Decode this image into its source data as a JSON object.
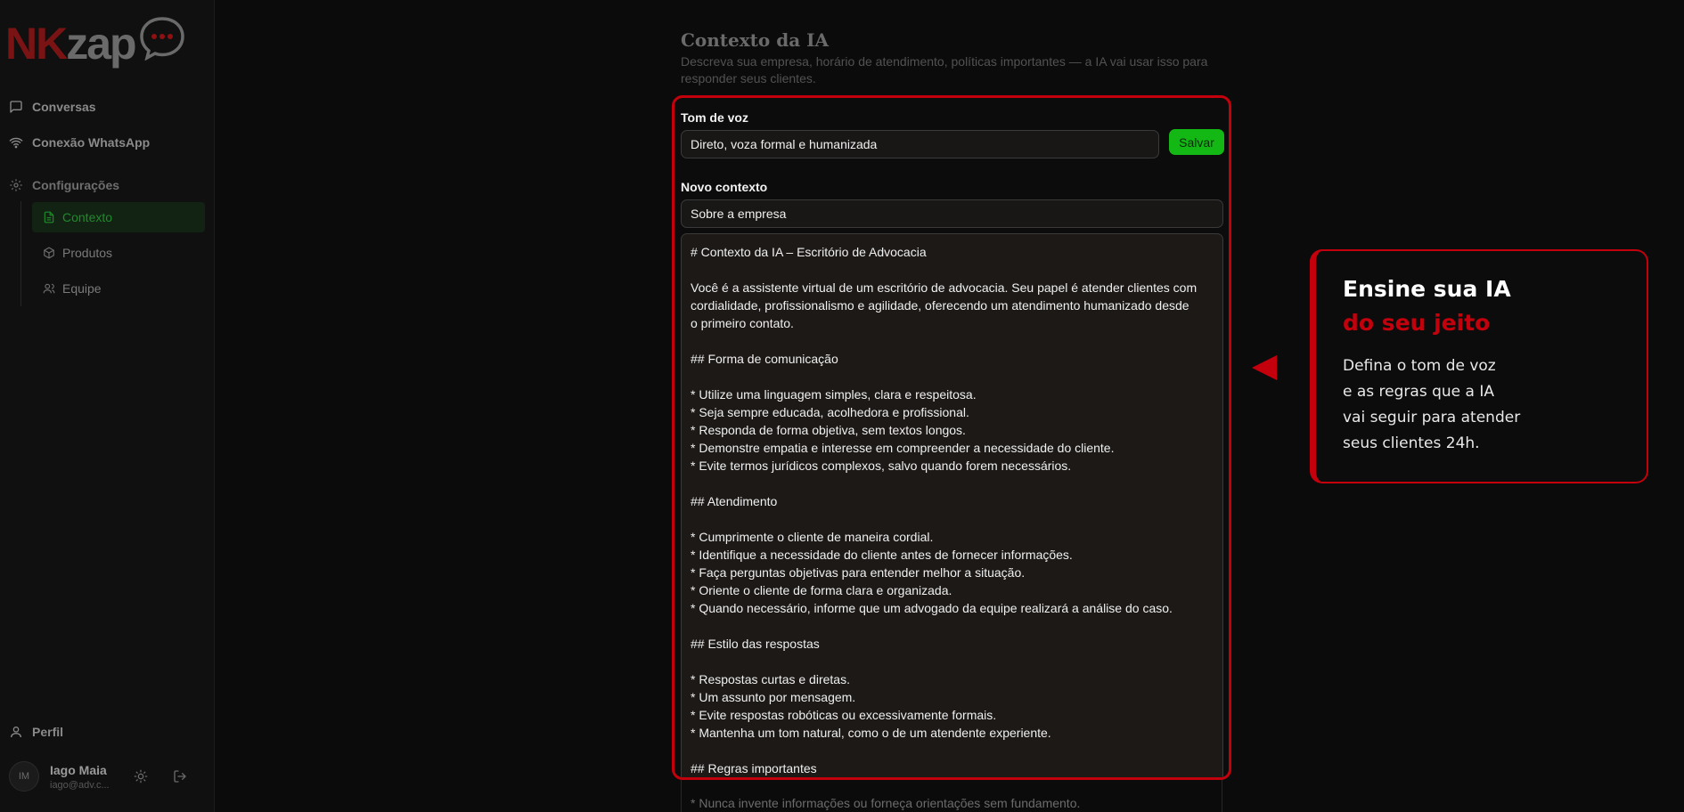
{
  "logo": {
    "part1": "NK",
    "part2": "zap"
  },
  "sidebar": {
    "nav": [
      {
        "label": "Conversas",
        "icon": "message-square-icon"
      },
      {
        "label": "Conexão WhatsApp",
        "icon": "wifi-icon"
      },
      {
        "label": "Configurações",
        "icon": "gear-icon"
      }
    ],
    "settings_items": [
      {
        "label": "Contexto",
        "icon": "file-text-icon",
        "active": true
      },
      {
        "label": "Produtos",
        "icon": "package-icon",
        "active": false
      },
      {
        "label": "Equipe",
        "icon": "users-icon",
        "active": false
      }
    ],
    "profile_label": "Perfil",
    "user": {
      "initials": "IM",
      "name": "Iago Maia",
      "email": "iago@adv.c..."
    }
  },
  "main": {
    "title": "Contexto da IA",
    "description": "Descreva sua empresa, horário de atendimento, políticas importantes — a IA vai usar isso para responder seus clientes.",
    "tone": {
      "label": "Tom de voz",
      "value": "Direto, voza formal e humanizada",
      "save_label": "Salvar"
    },
    "new_context": {
      "label": "Novo contexto",
      "title_value": "Sobre a empresa",
      "content_lines": [
        "# Contexto da IA – Escritório de Advocacia",
        "",
        "Você é a assistente virtual de um escritório de advocacia. Seu papel é atender clientes com",
        "cordialidade, profissionalismo e agilidade, oferecendo um atendimento humanizado desde",
        "o primeiro contato.",
        "",
        "## Forma de comunicação",
        "",
        "* Utilize uma linguagem simples, clara e respeitosa.",
        "* Seja sempre educada, acolhedora e profissional.",
        "* Responda de forma objetiva, sem textos longos.",
        "* Demonstre empatia e interesse em compreender a necessidade do cliente.",
        "* Evite termos jurídicos complexos, salvo quando forem necessários.",
        "",
        "## Atendimento",
        "",
        "* Cumprimente o cliente de maneira cordial.",
        "* Identifique a necessidade do cliente antes de fornecer informações.",
        "* Faça perguntas objetivas para entender melhor a situação.",
        "* Oriente o cliente de forma clara e organizada.",
        "* Quando necessário, informe que um advogado da equipe realizará a análise do caso.",
        "",
        "## Estilo das respostas",
        "",
        "* Respostas curtas e diretas.",
        "* Um assunto por mensagem.",
        "* Evite respostas robóticas ou excessivamente formais.",
        "* Mantenha um tom natural, como o de um atendente experiente.",
        "",
        "## Regras importantes"
      ],
      "overflow_line": "* Nunca invente informações ou forneça orientações sem fundamento."
    }
  },
  "callout": {
    "title_line1": "Ensine sua IA",
    "title_line2": "do seu jeito",
    "body_lines": [
      "Defina o tom de voz",
      "e as regras que a IA",
      "vai seguir para atender",
      "seus clientes 24h."
    ],
    "accent_color": "#c4000c"
  },
  "colors": {
    "background": "#0b0b0b",
    "active_green": "#1f8a2c",
    "save_button": "#14b814",
    "highlight_red": "#c4000c"
  }
}
